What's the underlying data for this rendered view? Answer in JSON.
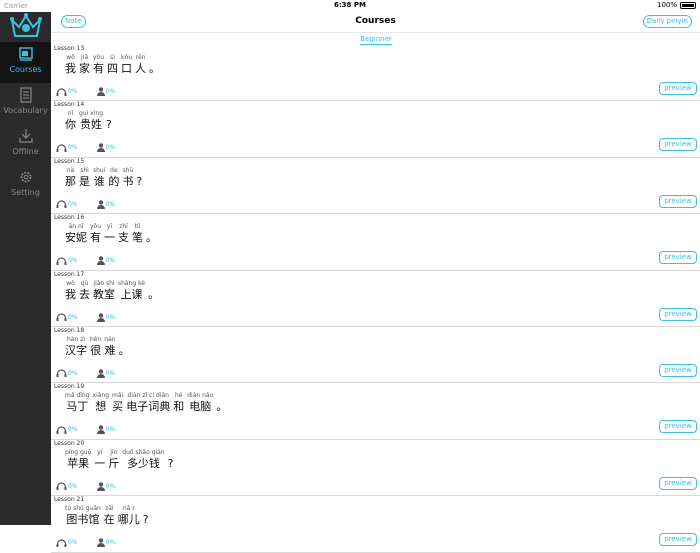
{
  "status_bar": {
    "carrier": "Carrier",
    "time": "6:38 PM",
    "battery": "100%"
  },
  "sidebar": {
    "items": [
      {
        "label": "Courses",
        "icon": "courses-icon",
        "active": true
      },
      {
        "label": "Vocabulary",
        "icon": "vocabulary-icon",
        "active": false
      },
      {
        "label": "Offline",
        "icon": "download-icon",
        "active": false
      },
      {
        "label": "Setting",
        "icon": "gear-icon",
        "active": false
      }
    ]
  },
  "header": {
    "title": "Courses",
    "note_label": "Note",
    "daily_pinyin_label": "Daily pinyin"
  },
  "level_tab": "Beginner",
  "preview_label": "preview",
  "colors": {
    "accent": "#3bc0e0",
    "sidebar": "#2b2b2b",
    "sidebar_active": "#141414"
  },
  "lessons": [
    {
      "lesson": "Lesson  13",
      "listen": "0%",
      "speak": "0%",
      "words": [
        {
          "py": "wǒ",
          "hz": "我"
        },
        {
          "py": "jiā",
          "hz": "家"
        },
        {
          "py": "yǒu",
          "hz": "有"
        },
        {
          "py": "sì",
          "hz": "四"
        },
        {
          "py": "kǒu",
          "hz": "口"
        },
        {
          "py": "rén",
          "hz": "人"
        }
      ],
      "punct": "。"
    },
    {
      "lesson": "Lesson  14",
      "listen": "0%",
      "speak": "0%",
      "words": [
        {
          "py": "nǐ",
          "hz": "你"
        },
        {
          "py": "guì xìng",
          "hz": "贵姓"
        }
      ],
      "punct": "?"
    },
    {
      "lesson": "Lesson  15",
      "listen": "0%",
      "speak": "0%",
      "words": [
        {
          "py": "nà",
          "hz": "那"
        },
        {
          "py": "shì",
          "hz": "是"
        },
        {
          "py": "shuí",
          "hz": "谁"
        },
        {
          "py": "de",
          "hz": "的"
        },
        {
          "py": "shū",
          "hz": "书"
        }
      ],
      "punct": "?"
    },
    {
      "lesson": "Lesson  16",
      "listen": "0%",
      "speak": "0%",
      "words": [
        {
          "py": "ān nī",
          "hz": "安妮"
        },
        {
          "py": "yǒu",
          "hz": "有"
        },
        {
          "py": "yī",
          "hz": "一"
        },
        {
          "py": "zhī",
          "hz": "支"
        },
        {
          "py": "bǐ",
          "hz": "笔"
        }
      ],
      "punct": "。"
    },
    {
      "lesson": "Lesson  17",
      "listen": "0%",
      "speak": "0%",
      "words": [
        {
          "py": "wǒ",
          "hz": "我"
        },
        {
          "py": "qù",
          "hz": "去"
        },
        {
          "py": "jiào shì",
          "hz": "教室"
        },
        {
          "py": "shàng kè",
          "hz": "上课"
        }
      ],
      "punct": "。"
    },
    {
      "lesson": "Lesson  18",
      "listen": "0%",
      "speak": "0%",
      "words": [
        {
          "py": "hàn zì",
          "hz": "汉字"
        },
        {
          "py": "hěn",
          "hz": "很"
        },
        {
          "py": "nán",
          "hz": "难"
        }
      ],
      "punct": "。"
    },
    {
      "lesson": "Lesson  19",
      "listen": "0%",
      "speak": "0%",
      "words": [
        {
          "py": "mǎ dīng",
          "hz": "马丁"
        },
        {
          "py": "xiǎng",
          "hz": "想"
        },
        {
          "py": "mǎi",
          "hz": "买"
        },
        {
          "py": "diàn zǐ cí diǎn",
          "hz": "电子词典"
        },
        {
          "py": "hé",
          "hz": "和"
        },
        {
          "py": "diàn nǎo",
          "hz": "电脑"
        }
      ],
      "punct": "。"
    },
    {
      "lesson": "Lesson  20",
      "listen": "0%",
      "speak": "0%",
      "words": [
        {
          "py": "píng guǒ",
          "hz": "苹果"
        },
        {
          "py": "yī",
          "hz": "一"
        },
        {
          "py": "jīn",
          "hz": "斤"
        },
        {
          "py": "duō shǎo qián",
          "hz": "多少钱"
        }
      ],
      "punct": "?"
    },
    {
      "lesson": "Lesson  21",
      "listen": "0%",
      "speak": "0%",
      "words": [
        {
          "py": "tú shū guǎn",
          "hz": "图书馆"
        },
        {
          "py": "zài",
          "hz": "在"
        },
        {
          "py": "nǎ r",
          "hz": "哪儿"
        }
      ],
      "punct": "?"
    }
  ]
}
